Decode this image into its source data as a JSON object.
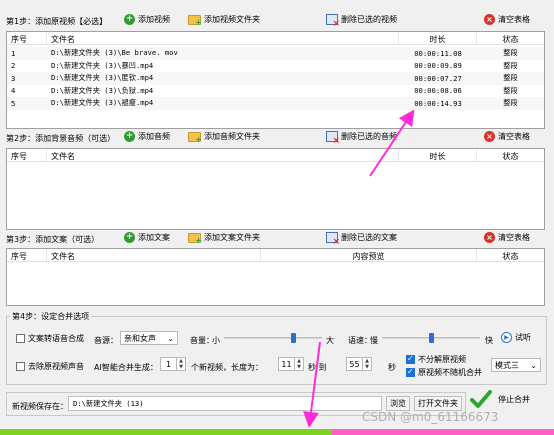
{
  "step1": {
    "label": "第1步：添加原视频【必选】",
    "add_btn": "添加视频",
    "add_folder_btn": "添加视频文件夹",
    "delete_btn": "删除已选的视频",
    "clear_btn": "清空表格",
    "columns": [
      "序号",
      "文件名",
      "时长",
      "状态"
    ],
    "rows": [
      {
        "no": "1",
        "name": "D:\\新建文件夹 (3)\\Be brave. mov",
        "duration": "00:00:11.08",
        "status": "整段"
      },
      {
        "no": "2",
        "name": "D:\\新建文件夹 (3)\\暴凹.mp4",
        "duration": "00:00:09.89",
        "status": "整段"
      },
      {
        "no": "3",
        "name": "D:\\新建文件夹 (3)\\匿钦.mp4",
        "duration": "00:00:07.27",
        "status": "整段"
      },
      {
        "no": "4",
        "name": "D:\\新建文件夹 (3)\\负狱.mp4",
        "duration": "00:00:08.06",
        "status": "整段"
      },
      {
        "no": "5",
        "name": "D:\\新建文件夹 (3)\\褪瘦.mp4",
        "duration": "00:00:14.93",
        "status": "整段"
      }
    ]
  },
  "step2": {
    "label": "第2步：添加背景音频（可选）",
    "add_btn": "添加音频",
    "add_folder_btn": "添加音频文件夹",
    "delete_btn": "删除已选的音频",
    "clear_btn": "清空表格",
    "columns": [
      "序号",
      "文件名",
      "时长",
      "状态"
    ]
  },
  "step3": {
    "label": "第3步：添加文案（可选）",
    "add_btn": "添加文案",
    "add_folder_btn": "添加文案文件夹",
    "delete_btn": "删除已选的文案",
    "clear_btn": "清空表格",
    "columns": [
      "序号",
      "文件名",
      "内容预览",
      "状态"
    ]
  },
  "step4": {
    "label": "第4步：设定合并选项",
    "tts_checkbox": "文案转语音合成",
    "voice_label": "音源：",
    "voice_value": "亲和女声",
    "volume_label": "音量：",
    "volume_min": "小",
    "volume_max": "大",
    "volume_level": 0.72,
    "speed_label": "语速：",
    "speed_min": "慢",
    "speed_max": "快",
    "speed_level": 0.5,
    "preview_btn": "试听",
    "remove_audio_checkbox": "去除原视频声音",
    "ai_label": "AI智能合并生成：",
    "ai_count": "1",
    "ai_count_suffix": "个新视频，长度为：",
    "length_min": "11",
    "length_min_suffix": "秒 到",
    "length_max": "55",
    "length_max_suffix": "秒",
    "no_split_checkbox": "不分解原视频",
    "no_random_checkbox": "原视频不随机合并",
    "mode_value": "模式三"
  },
  "save": {
    "label": "新视频保存在：",
    "path": "D:\\新建文件夹 (13)",
    "browse_btn": "浏览",
    "open_folder_btn": "打开文件夹",
    "stop_btn": "停止合并"
  },
  "watermark": "CSDN @m0_61166673",
  "progress": 0.6,
  "colors": {
    "progress_green": "#7ed321",
    "progress_pink": "#ff5ec4",
    "annotation_arrow": "#ff2bd6",
    "accent_blue": "#1f6fd8"
  }
}
